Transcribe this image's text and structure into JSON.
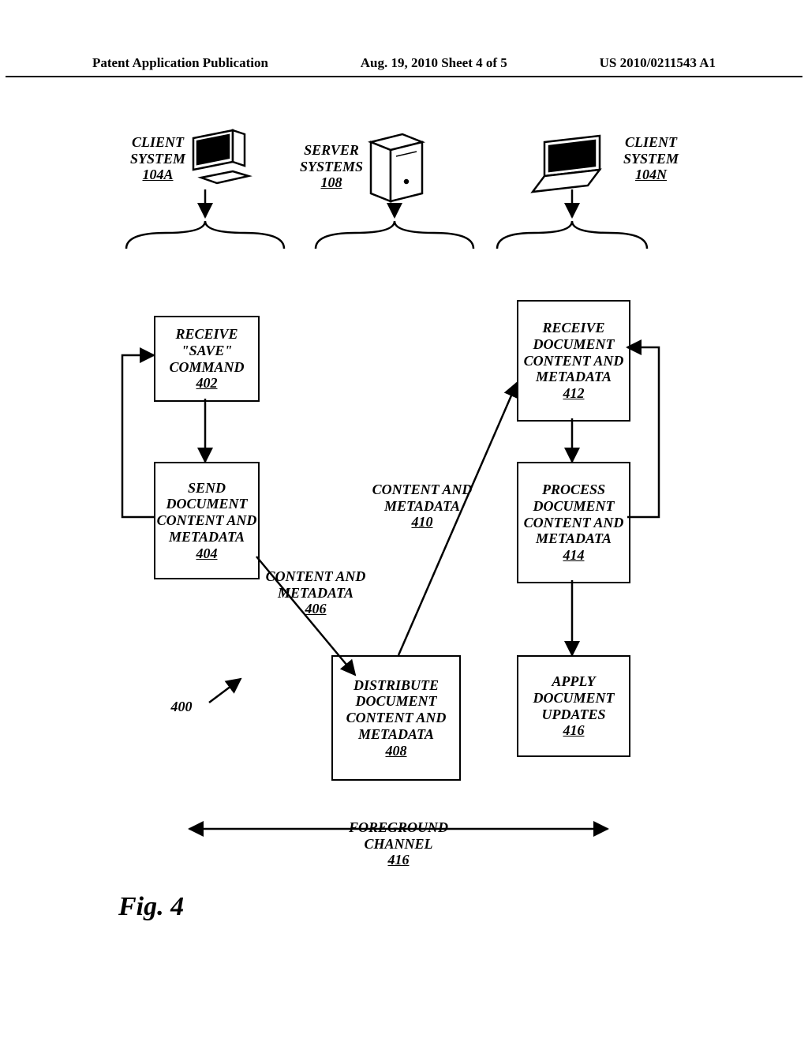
{
  "header": {
    "left": "Patent Application Publication",
    "center": "Aug. 19, 2010  Sheet 4 of 5",
    "right": "US 2010/0211543 A1"
  },
  "entities": {
    "client_a": {
      "title": "CLIENT SYSTEM",
      "ref": "104A"
    },
    "server": {
      "title": "SERVER SYSTEMS",
      "ref": "108"
    },
    "client_n": {
      "title": "CLIENT SYSTEM",
      "ref": "104N"
    }
  },
  "boxes": {
    "b402": {
      "lines": "RECEIVE \"SAVE\" COMMAND",
      "ref": "402"
    },
    "b404": {
      "lines": "SEND DOCUMENT CONTENT AND METADATA",
      "ref": "404"
    },
    "b408": {
      "lines": "DISTRIBUTE DOCUMENT CONTENT AND METADATA",
      "ref": "408"
    },
    "b412": {
      "lines": "RECEIVE DOCUMENT CONTENT AND METADATA",
      "ref": "412"
    },
    "b414": {
      "lines": "PROCESS DOCUMENT CONTENT AND METADATA",
      "ref": "414"
    },
    "b416": {
      "lines": "APPLY DOCUMENT UPDATES",
      "ref": "416"
    }
  },
  "edge_labels": {
    "l406": {
      "text": "CONTENT AND METADATA",
      "ref": "406"
    },
    "l410": {
      "text": "CONTENT AND METADATA",
      "ref": "410"
    }
  },
  "figure_ref": "400",
  "channel": {
    "text": "FOREGROUND CHANNEL",
    "ref": "416"
  },
  "caption": "Fig. 4"
}
